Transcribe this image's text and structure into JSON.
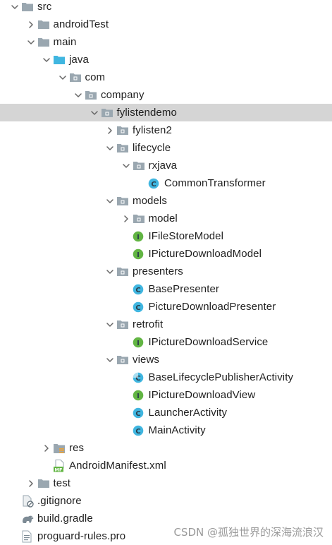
{
  "project_tree": {
    "items": [
      {
        "label": "src",
        "depth": 0,
        "expander": "expanded",
        "icon": "folder-icon"
      },
      {
        "label": "androidTest",
        "depth": 1,
        "expander": "collapsed",
        "icon": "folder-icon"
      },
      {
        "label": "main",
        "depth": 1,
        "expander": "expanded",
        "icon": "folder-icon"
      },
      {
        "label": "java",
        "depth": 2,
        "expander": "expanded",
        "icon": "source-folder-icon"
      },
      {
        "label": "com",
        "depth": 3,
        "expander": "expanded",
        "icon": "package-icon"
      },
      {
        "label": "company",
        "depth": 4,
        "expander": "expanded",
        "icon": "package-icon"
      },
      {
        "label": "fylistendemo",
        "depth": 5,
        "expander": "expanded",
        "icon": "package-icon",
        "selected": true
      },
      {
        "label": "fylisten2",
        "depth": 6,
        "expander": "collapsed",
        "icon": "package-icon"
      },
      {
        "label": "lifecycle",
        "depth": 6,
        "expander": "expanded",
        "icon": "package-icon"
      },
      {
        "label": "rxjava",
        "depth": 7,
        "expander": "expanded",
        "icon": "package-icon"
      },
      {
        "label": "CommonTransformer",
        "depth": 8,
        "expander": "none",
        "icon": "class-icon"
      },
      {
        "label": "models",
        "depth": 6,
        "expander": "expanded",
        "icon": "package-icon"
      },
      {
        "label": "model",
        "depth": 7,
        "expander": "collapsed",
        "icon": "package-icon"
      },
      {
        "label": "IFileStoreModel",
        "depth": 7,
        "expander": "none",
        "icon": "interface-icon"
      },
      {
        "label": "IPictureDownloadModel",
        "depth": 7,
        "expander": "none",
        "icon": "interface-icon"
      },
      {
        "label": "presenters",
        "depth": 6,
        "expander": "expanded",
        "icon": "package-icon"
      },
      {
        "label": "BasePresenter",
        "depth": 7,
        "expander": "none",
        "icon": "class-icon"
      },
      {
        "label": "PictureDownloadPresenter",
        "depth": 7,
        "expander": "none",
        "icon": "class-icon"
      },
      {
        "label": "retrofit",
        "depth": 6,
        "expander": "expanded",
        "icon": "package-icon"
      },
      {
        "label": "IPictureDownloadService",
        "depth": 7,
        "expander": "none",
        "icon": "interface-icon"
      },
      {
        "label": "views",
        "depth": 6,
        "expander": "expanded",
        "icon": "package-icon"
      },
      {
        "label": "BaseLifecyclePublisherActivity",
        "depth": 7,
        "expander": "none",
        "icon": "abstract-class-icon"
      },
      {
        "label": "IPictureDownloadView",
        "depth": 7,
        "expander": "none",
        "icon": "interface-icon"
      },
      {
        "label": "LauncherActivity",
        "depth": 7,
        "expander": "none",
        "icon": "class-icon"
      },
      {
        "label": "MainActivity",
        "depth": 7,
        "expander": "none",
        "icon": "class-icon"
      },
      {
        "label": "res",
        "depth": 2,
        "expander": "collapsed",
        "icon": "resources-folder-icon"
      },
      {
        "label": "AndroidManifest.xml",
        "depth": 2,
        "expander": "none",
        "icon": "manifest-file-icon"
      },
      {
        "label": "test",
        "depth": 1,
        "expander": "collapsed",
        "icon": "folder-icon"
      },
      {
        "label": ".gitignore",
        "depth": 0,
        "expander": "none",
        "icon": "gitignore-file-icon"
      },
      {
        "label": "build.gradle",
        "depth": 0,
        "expander": "none",
        "icon": "gradle-file-icon"
      },
      {
        "label": "proguard-rules.pro",
        "depth": 0,
        "expander": "none",
        "icon": "text-file-icon"
      }
    ]
  },
  "watermark": "CSDN @孤独世界的深海流浪汉",
  "colors": {
    "folder": "#9aa7b0",
    "source_folder": "#40b6e0",
    "class": "#40b6e0",
    "interface": "#62b543",
    "selected_row": "#d5d5d5",
    "text": "#1f1f1f"
  }
}
